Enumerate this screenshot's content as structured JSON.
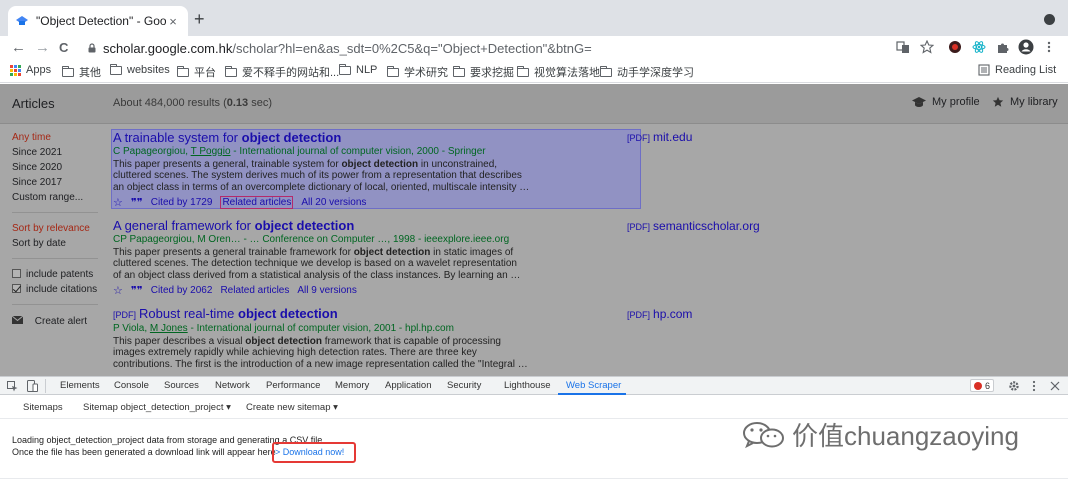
{
  "browser": {
    "tab_title": "\"Object Detection\" - Google Sc",
    "tab_close": "×",
    "new_tab": "+",
    "back": "←",
    "forward": "→",
    "reload": "C",
    "url_host": "scholar.google.com.hk",
    "url_path": "/scholar?hl=en&as_sdt=0%2C5&q=\"Object+Detection\"&btnG="
  },
  "bookmarks": {
    "items": [
      "Apps",
      "其他",
      "websites",
      "平台",
      "爱不释手的网站和...",
      "NLP",
      "学术研究",
      "要求挖掘",
      "视觉算法落地",
      "动手学深度学习"
    ],
    "reading_list": "Reading List"
  },
  "scholar": {
    "articles_label": "Articles",
    "results_prefix": "About 484,000 results (",
    "results_time": "0.13",
    "results_suffix": " sec)",
    "my_profile": "My profile",
    "my_library": "My library",
    "sidebar": {
      "any_time": "Any time",
      "since_2021": "Since 2021",
      "since_2020": "Since 2020",
      "since_2017": "Since 2017",
      "custom_range": "Custom range...",
      "sort_relevance": "Sort by relevance",
      "sort_date": "Sort by date",
      "include_patents": "include patents",
      "include_citations": "include citations",
      "create_alert": "Create alert"
    },
    "results": [
      {
        "title_pre": "A trainable system for ",
        "title_bold": "object detection",
        "title_post": "",
        "authors_pre": "C Papageorgiou, ",
        "authors_link": "T Poggio",
        "authors_post": " - International journal of computer vision, 2000 - Springer",
        "snippet_1a": "This paper presents a general, trainable system for ",
        "snippet_1b": "object detection",
        "snippet_1c": " in unconstrained,",
        "snippet_2": "cluttered scenes. The system derives much of its power from a representation that describes",
        "snippet_3": "an object class in terms of an overcomplete dictionary of local, oriented, multiscale intensity …",
        "cited": "Cited by 1729",
        "related": "Related articles",
        "versions": "All 20 versions",
        "side_pdf": "[PDF]",
        "side_domain": "mit.edu"
      },
      {
        "title_pre": "A general framework for ",
        "title_bold": "object detection",
        "title_post": "",
        "authors_pre": "CP Papageorgiou, M Oren… - … Conference on Computer …, 1998 - ieeexplore.ieee.org",
        "authors_link": "",
        "authors_post": "",
        "snippet_1a": "This paper presents a general trainable framework for ",
        "snippet_1b": "object detection",
        "snippet_1c": " in static images of",
        "snippet_2": "cluttered scenes. The detection technique we develop is based on a wavelet representation",
        "snippet_3": "of an object class derived from a statistical analysis of the class instances. By learning an …",
        "cited": "Cited by 2062",
        "related": "Related articles",
        "versions": "All 9 versions",
        "side_pdf": "[PDF]",
        "side_domain": "semanticscholar.org"
      },
      {
        "title_tag": "[PDF]",
        "title_pre": "Robust real-time ",
        "title_bold": "object detection",
        "title_post": "",
        "authors_pre": "P Viola, ",
        "authors_link": "M Jones",
        "authors_post": " - International journal of computer vision, 2001 - hpl.hp.com",
        "snippet_1a": "This paper describes a visual ",
        "snippet_1b": "object detection",
        "snippet_1c": " framework that is capable of processing",
        "snippet_2": "images extremely rapidly while achieving high detection rates. There are three key",
        "snippet_3": "contributions. The first is the introduction of a new image representation called the \"Integral …",
        "side_pdf": "[PDF]",
        "side_domain": "hp.com"
      }
    ]
  },
  "devtools": {
    "tabs": [
      "Elements",
      "Console",
      "Sources",
      "Network",
      "Performance",
      "Memory",
      "Application",
      "Security",
      "Lighthouse",
      "Web Scraper"
    ],
    "error_count": "6",
    "sub_tabs": [
      "Sitemaps",
      "Sitemap object_detection_project ▾",
      "Create new sitemap ▾"
    ],
    "message_1": "Loading object_detection_project data from storage and generating a CSV file.",
    "message_2": "Once the file has been generated a download link will appear here",
    "download_link": "> Download now!"
  },
  "watermark": "价值chuangzaoying",
  "colors": {
    "link": "#1a0dab",
    "green": "#006621",
    "red_filter": "#a52714",
    "devtools_active": "#1a73e8",
    "highlight_box": "#e53935"
  }
}
